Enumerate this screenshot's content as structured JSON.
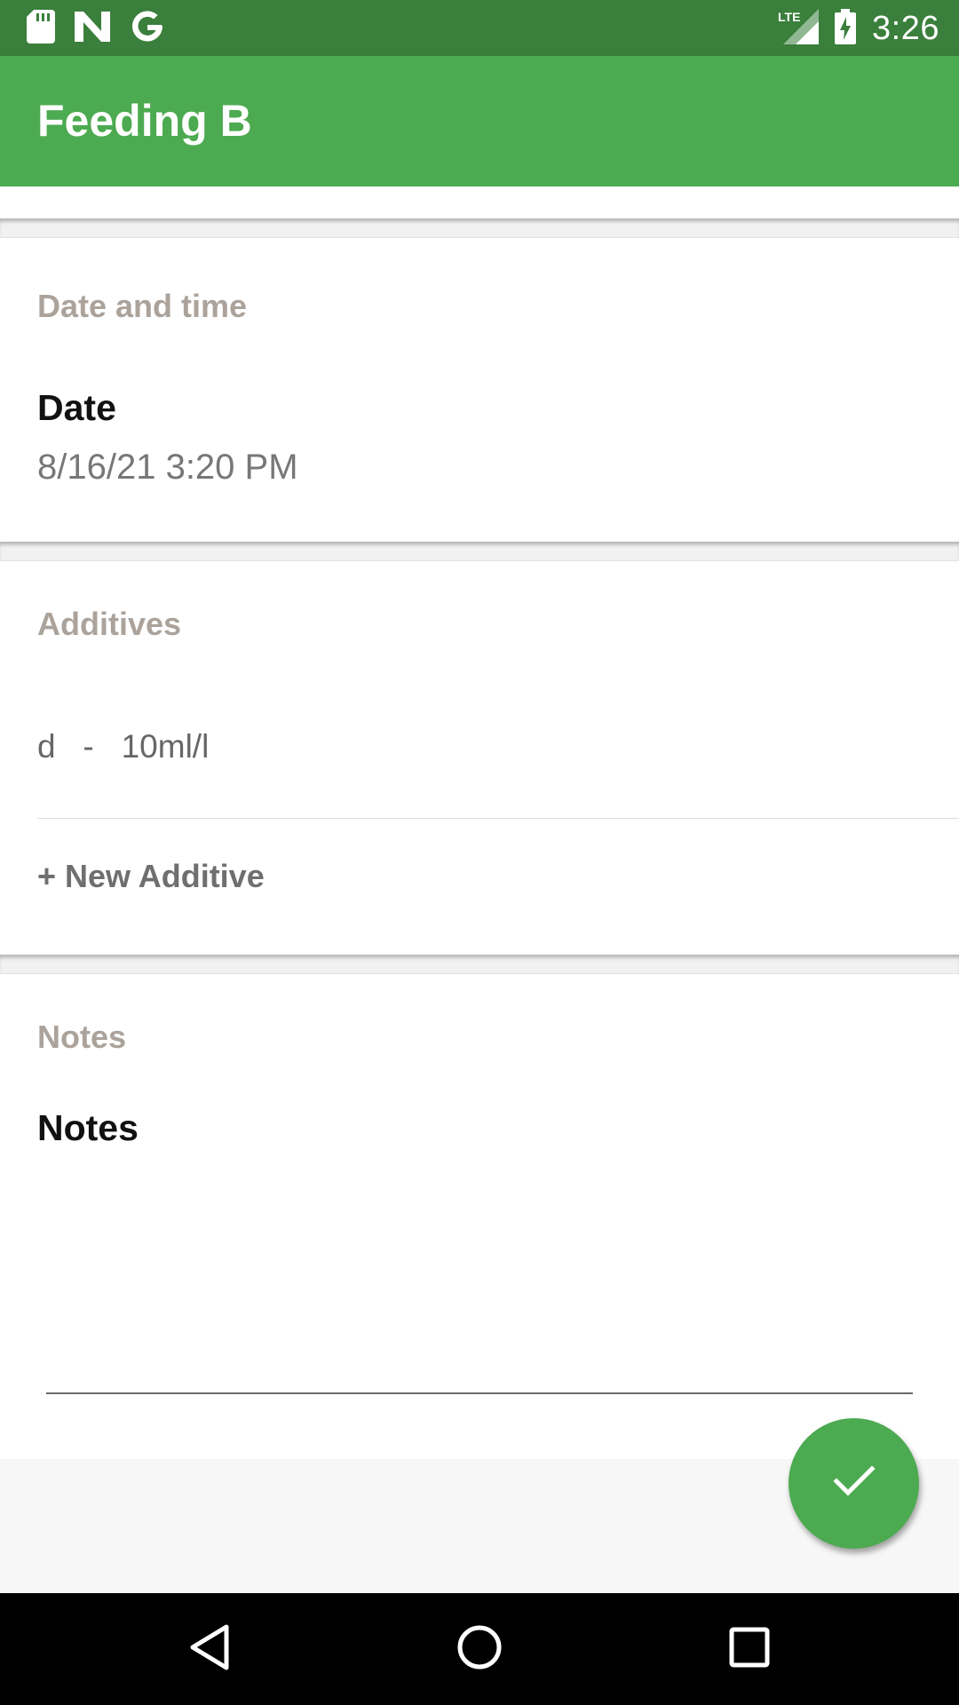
{
  "status_bar": {
    "icons": [
      "sd-card-icon",
      "n-logo-icon",
      "google-g-icon",
      "lte-signal-icon",
      "battery-charging-icon"
    ],
    "network": "LTE",
    "time": "3:26"
  },
  "app_bar": {
    "title": "Feeding B"
  },
  "date_section": {
    "title": "Date and time",
    "date_label": "Date",
    "date_value": "8/16/21 3:20 PM"
  },
  "additives_section": {
    "title": "Additives",
    "items": [
      {
        "name": "d",
        "separator": "-",
        "amount": "10ml/l"
      }
    ],
    "new_label": "+ New Additive"
  },
  "notes_section": {
    "title": "Notes",
    "field_label": "Notes",
    "value": ""
  },
  "fab": {
    "icon": "check-icon"
  },
  "nav_bar": {
    "icons": [
      "back-icon",
      "home-icon",
      "recents-icon"
    ]
  },
  "colors": {
    "status_bar": "#3a7f3b",
    "primary": "#4caa50",
    "section_title": "#aba39b"
  }
}
